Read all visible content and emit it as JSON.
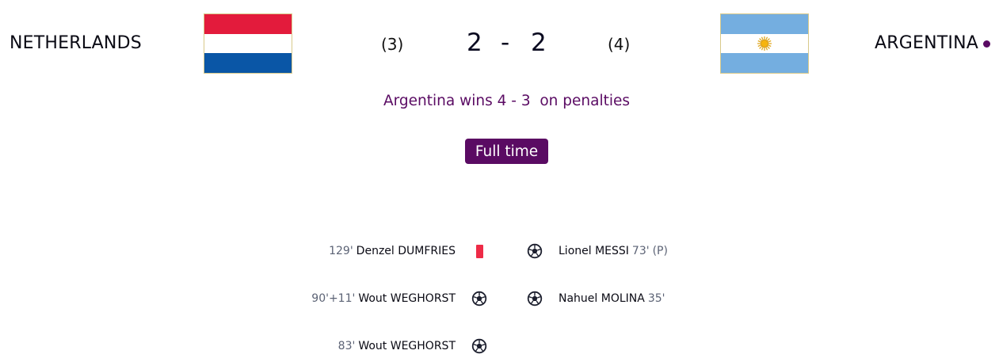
{
  "home": {
    "name": "NETHERLANDS",
    "score": "2",
    "penalty_score": "(3)"
  },
  "away": {
    "name": "ARGENTINA",
    "score": "2",
    "penalty_score": "(4)"
  },
  "score_separator": "-",
  "result_text": "Argentina wins 4 - 3  on penalties",
  "status": "Full time",
  "colors": {
    "accent": "#5a0b63",
    "red_card": "#ee2b47",
    "nl_red": "#e31b3c",
    "nl_blue": "#0a56a6",
    "ar_blue": "#74aee0"
  },
  "events": {
    "home": [
      {
        "minute": "129'",
        "player": "Denzel DUMFRIES",
        "icon": "red-card-icon"
      },
      {
        "minute": "90'+11'",
        "player": "Wout WEGHORST",
        "icon": "goal-ball-icon"
      },
      {
        "minute": "83'",
        "player": "Wout WEGHORST",
        "icon": "goal-ball-icon"
      }
    ],
    "away": [
      {
        "player": "Lionel MESSI",
        "minute": "73'",
        "note": "(P)",
        "icon": "goal-ball-icon"
      },
      {
        "player": "Nahuel MOLINA",
        "minute": "35'",
        "icon": "goal-ball-icon"
      }
    ]
  }
}
